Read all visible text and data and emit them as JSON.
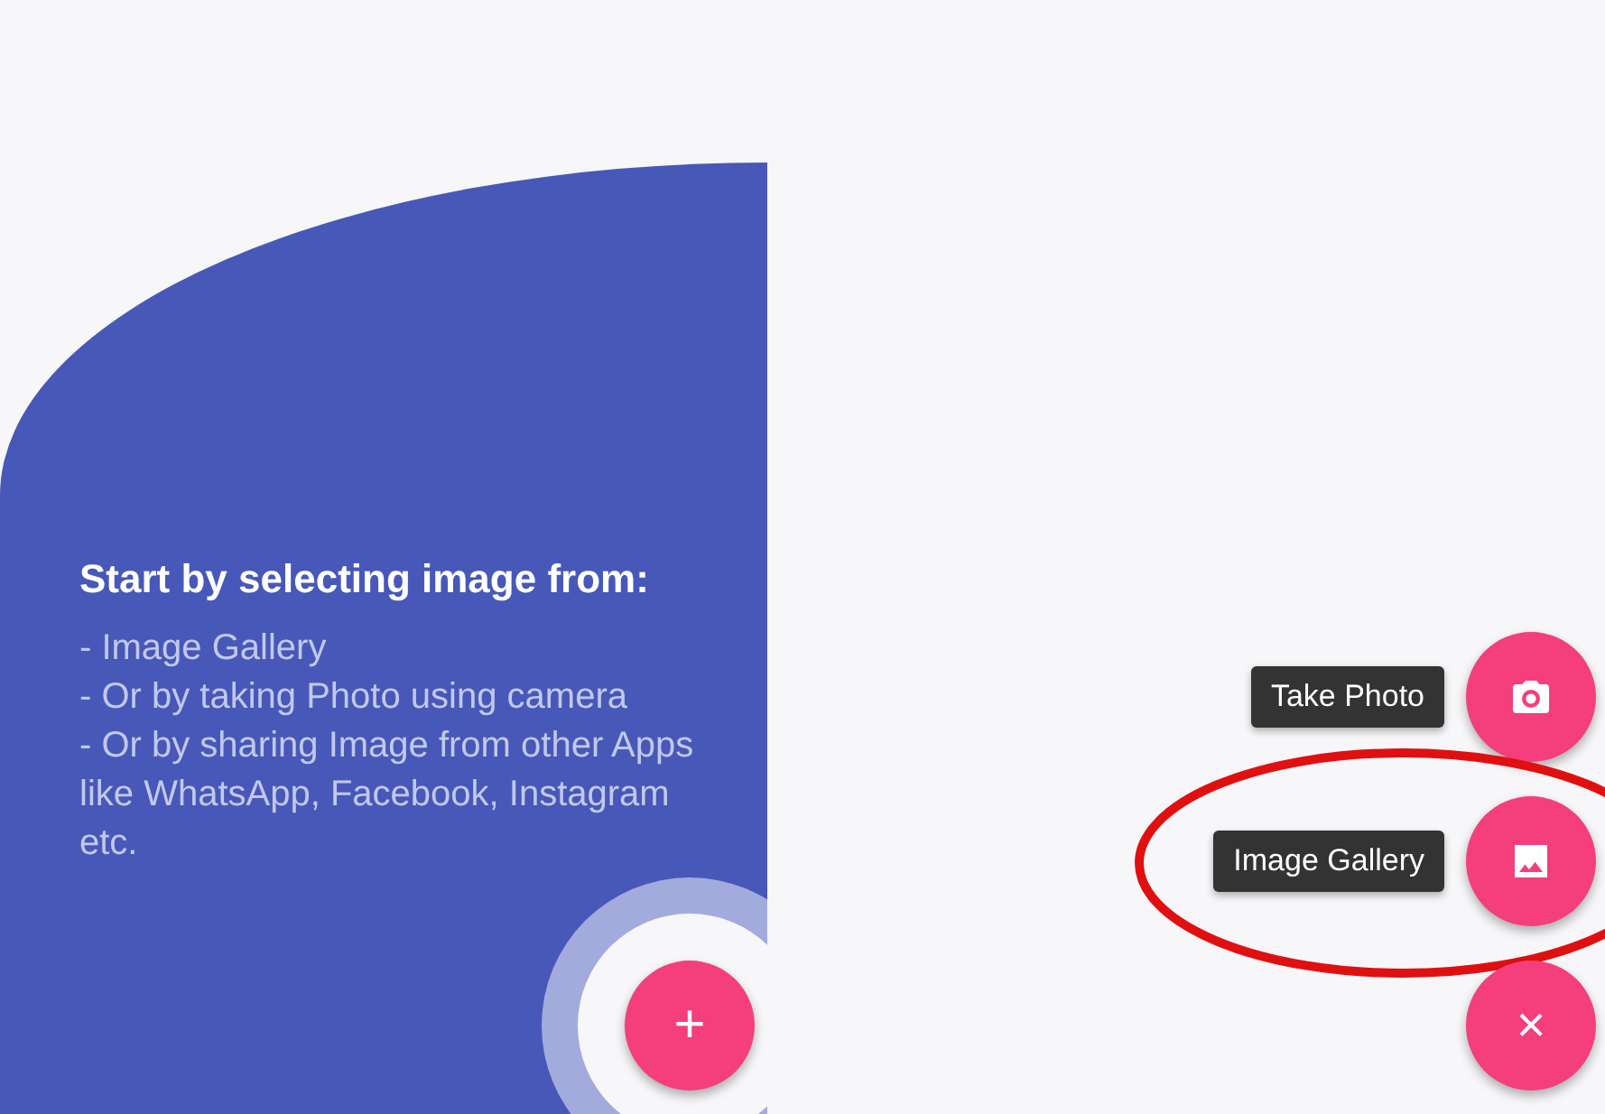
{
  "panel": {
    "title": "Start by selecting image from:",
    "lines": [
      "- Image Gallery",
      "- Or by taking Photo using camera",
      "- Or by sharing Image from other Apps like WhatsApp, Facebook, Instagram etc."
    ]
  },
  "main_fab": {
    "label": "+"
  },
  "speed_dial": {
    "actions": [
      {
        "kind": "camera",
        "label": "Take Photo",
        "circled": false
      },
      {
        "kind": "gallery",
        "label": "Image Gallery",
        "circled": true
      }
    ],
    "close": {
      "label": "×"
    }
  }
}
